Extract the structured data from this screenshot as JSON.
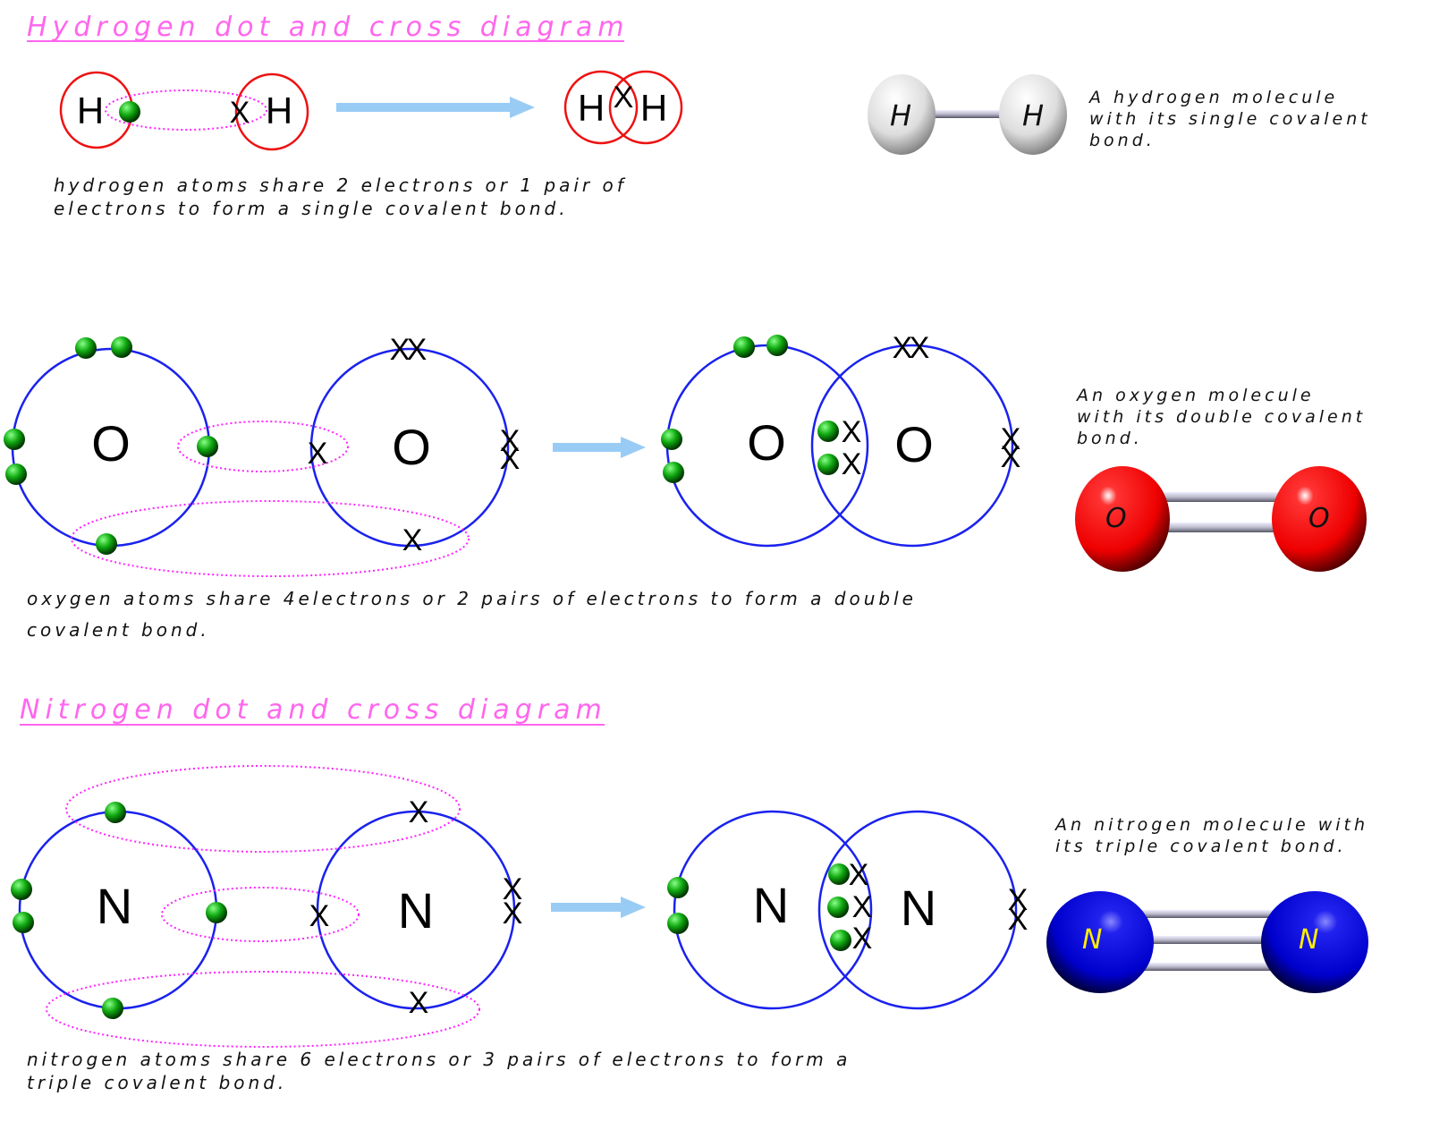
{
  "colors": {
    "title": "#ff66ee",
    "hydrogen_shell": "#ee1111",
    "shell": "#1a22ee",
    "overlap": "#ff22ff",
    "arrow": "#99ccf5",
    "electron_dot": "#11aa11",
    "oxygen_atom": "#ee0000",
    "nitrogen_atom": "#0000dd",
    "nitrogen_label": "#ffee00"
  },
  "hydrogen": {
    "title": "Hydrogen dot and cross diagram",
    "atom_symbol": "H",
    "cross": "X",
    "caption_line1": "hydrogen atoms share 2 electrons or 1 pair of",
    "caption_line2": "electrons to form a single covalent bond.",
    "model_line1": "A hydrogen molecule",
    "model_line2": "with its single covalent",
    "model_line3": "bond."
  },
  "oxygen": {
    "atom_symbol": "O",
    "caption_line1": "oxygen atoms share 4electrons or 2 pairs of electrons to form a double",
    "caption_line2": "covalent bond.",
    "model_line1": "An oxygen molecule",
    "model_line2": "with its double covalent",
    "model_line3": "bond."
  },
  "nitrogen": {
    "title": "Nitrogen dot and cross diagram",
    "atom_symbol": "N",
    "caption_line1": "nitrogen atoms share 6 electrons or 3 pairs of electrons to form a",
    "caption_line2": "triple covalent bond.",
    "model_line1": "An nitrogen molecule with",
    "model_line2": "its triple covalent bond."
  }
}
